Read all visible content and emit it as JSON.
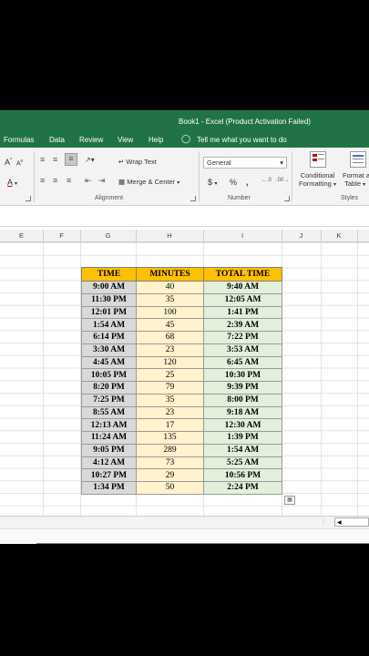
{
  "titlebar": {
    "title": "Book1  -  Excel (Product Activation Failed)"
  },
  "menu": {
    "formulas": "Formulas",
    "data": "Data",
    "review": "Review",
    "view": "View",
    "help": "Help",
    "tell_me": "Tell me what you want to do"
  },
  "ribbon": {
    "font_grow": "A",
    "font_shrink": "A",
    "wrap_text": "Wrap Text",
    "merge_center": "Merge & Center",
    "number_format": "General",
    "currency": "$",
    "percent": "%",
    "comma": ",",
    "conditional_formatting_line1": "Conditional",
    "conditional_formatting_line2": "Formatting",
    "format_as_table_line1": "Format a",
    "format_as_table_line2": "Table",
    "group_alignment": "Alignment",
    "group_number": "Number",
    "group_styles": "Styles"
  },
  "columns": [
    "E",
    "F",
    "G",
    "H",
    "I",
    "J",
    "K"
  ],
  "table": {
    "headers": [
      "TIME",
      "MINUTES",
      "TOTAL TIME"
    ],
    "rows": [
      [
        "9:00 AM",
        "40",
        "9:40 AM"
      ],
      [
        "11:30 PM",
        "35",
        "12:05 AM"
      ],
      [
        "12:01 PM",
        "100",
        "1:41 PM"
      ],
      [
        "1:54 AM",
        "45",
        "2:39 AM"
      ],
      [
        "6:14 PM",
        "68",
        "7:22 PM"
      ],
      [
        "3:30 AM",
        "23",
        "3:53 AM"
      ],
      [
        "4:45 AM",
        "120",
        "6:45 AM"
      ],
      [
        "10:05 PM",
        "25",
        "10:30 PM"
      ],
      [
        "8:20 PM",
        "79",
        "9:39 PM"
      ],
      [
        "7:25 PM",
        "35",
        "8:00 PM"
      ],
      [
        "8:55 AM",
        "23",
        "9:18 AM"
      ],
      [
        "12:13 AM",
        "17",
        "12:30 AM"
      ],
      [
        "11:24 AM",
        "135",
        "1:39 PM"
      ],
      [
        "9:05 PM",
        "289",
        "1:54 AM"
      ],
      [
        "4:12 AM",
        "73",
        "5:25 AM"
      ],
      [
        "10:27 PM",
        "29",
        "10:56 PM"
      ],
      [
        "1:34 PM",
        "50",
        "2:24 PM"
      ]
    ]
  },
  "colors": {
    "excel_green": "#217346",
    "header_fill": "#ffc000",
    "time_fill": "#d9d9d9",
    "minutes_fill": "#fff2cc",
    "total_fill": "#e2efda"
  },
  "icons": [
    "lightbulb-icon",
    "wrap-text-icon",
    "merge-center-icon",
    "conditional-formatting-icon",
    "format-as-table-icon",
    "quick-analysis-icon"
  ]
}
